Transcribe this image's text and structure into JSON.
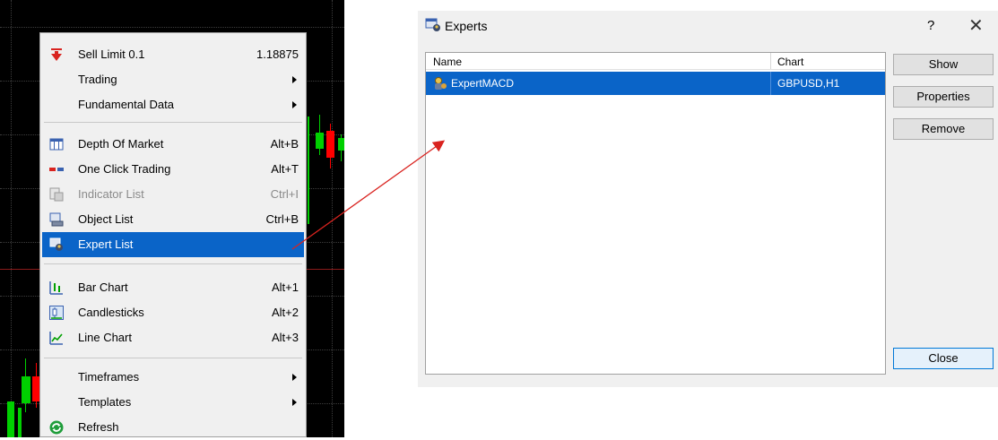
{
  "context_menu": {
    "items": [
      {
        "label": "Sell Limit 0.1",
        "shortcut": "1.18875",
        "icon": "sell-limit-arrow-icon",
        "submenu": false,
        "disabled": false
      },
      {
        "label": "Trading",
        "shortcut": "",
        "icon": "",
        "submenu": true,
        "disabled": false
      },
      {
        "label": "Fundamental Data",
        "shortcut": "",
        "icon": "",
        "submenu": true,
        "disabled": false
      },
      {
        "label": "Depth Of Market",
        "shortcut": "Alt+B",
        "icon": "depth-of-market-icon",
        "submenu": false,
        "disabled": false
      },
      {
        "label": "One Click Trading",
        "shortcut": "Alt+T",
        "icon": "one-click-trading-icon",
        "submenu": false,
        "disabled": false
      },
      {
        "label": "Indicator List",
        "shortcut": "Ctrl+I",
        "icon": "indicator-list-icon",
        "submenu": false,
        "disabled": true
      },
      {
        "label": "Object List",
        "shortcut": "Ctrl+B",
        "icon": "object-list-icon",
        "submenu": false,
        "disabled": false
      },
      {
        "label": "Expert List",
        "shortcut": "",
        "icon": "expert-list-icon",
        "submenu": false,
        "disabled": false,
        "selected": true
      },
      {
        "label": "Bar Chart",
        "shortcut": "Alt+1",
        "icon": "bar-chart-icon",
        "submenu": false,
        "disabled": false
      },
      {
        "label": "Candlesticks",
        "shortcut": "Alt+2",
        "icon": "candlesticks-icon",
        "submenu": false,
        "disabled": false
      },
      {
        "label": "Line Chart",
        "shortcut": "Alt+3",
        "icon": "line-chart-icon",
        "submenu": false,
        "disabled": false
      },
      {
        "label": "Timeframes",
        "shortcut": "",
        "icon": "",
        "submenu": true,
        "disabled": false
      },
      {
        "label": "Templates",
        "shortcut": "",
        "icon": "",
        "submenu": true,
        "disabled": false
      },
      {
        "label": "Refresh",
        "shortcut": "",
        "icon": "refresh-icon",
        "submenu": false,
        "disabled": false
      }
    ]
  },
  "dialog": {
    "title": "Experts",
    "help_label": "?",
    "close_label": "✕",
    "columns": [
      "Name",
      "Chart"
    ],
    "rows": [
      {
        "name": "ExpertMACD",
        "chart": "GBPUSD,H1",
        "selected": true
      }
    ],
    "buttons": {
      "show": "Show",
      "properties": "Properties",
      "remove": "Remove",
      "close": "Close"
    }
  },
  "colors": {
    "selection": "#0a64c8",
    "menu_bg": "#f0f0f0",
    "chart_bg": "#000000",
    "bull_candle": "#00d000",
    "bear_candle": "#ff0000",
    "arrow": "#d9231f"
  }
}
